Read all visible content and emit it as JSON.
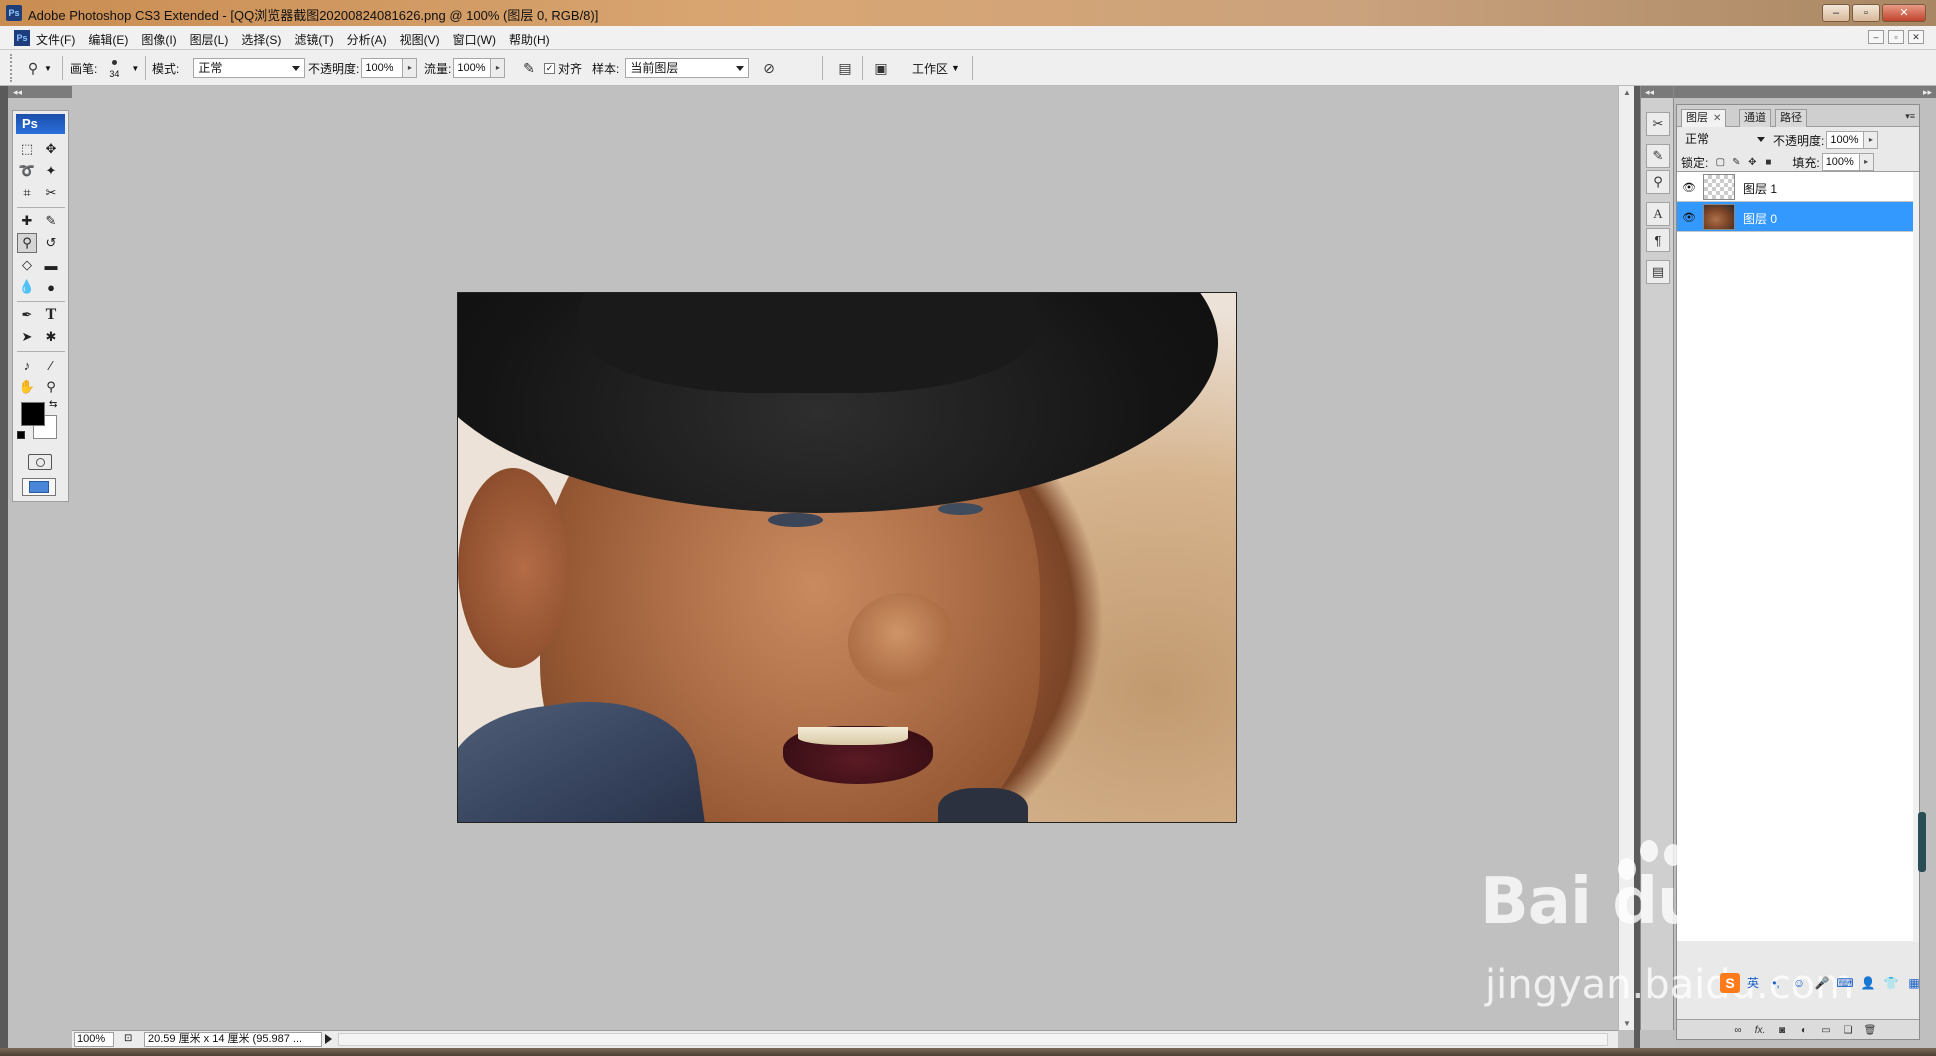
{
  "window": {
    "app_icon": "Ps",
    "title": "Adobe Photoshop CS3 Extended - [QQ浏览器截图20200824081626.png @ 100% (图层 0, RGB/8)]",
    "buttons": {
      "minimize": "–",
      "maximize": "▫",
      "close": "✕"
    }
  },
  "menubar": {
    "icon": "Ps",
    "items": [
      "文件(F)",
      "编辑(E)",
      "图像(I)",
      "图层(L)",
      "选择(S)",
      "滤镜(T)",
      "分析(A)",
      "视图(V)",
      "窗口(W)",
      "帮助(H)"
    ],
    "doc_buttons": [
      "–",
      "▫",
      "✕"
    ]
  },
  "options": {
    "brush_label": "画笔:",
    "brush_size": "34",
    "mode_label": "模式:",
    "mode_value": "正常",
    "opacity_label": "不透明度:",
    "opacity_value": "100%",
    "flow_label": "流量:",
    "flow_value": "100%",
    "aligned_label": "对齐",
    "aligned_checked": "✓",
    "sample_label": "样本:",
    "sample_value": "当前图层",
    "workspace_label": "工作区"
  },
  "toolbox": {
    "logo": "Ps"
  },
  "statusbar": {
    "zoom": "100%",
    "doc_info": "20.59 厘米 x 14 厘米 (95.987 ..."
  },
  "layers_panel": {
    "tabs": [
      {
        "label": "图层",
        "close": "✕"
      },
      {
        "label": "通道"
      },
      {
        "label": "路径"
      }
    ],
    "blend_mode": "正常",
    "opacity_label": "不透明度:",
    "opacity_value": "100%",
    "lock_label": "锁定:",
    "fill_label": "填充:",
    "fill_value": "100%",
    "layers": [
      {
        "name": "图层 1",
        "selected": false
      },
      {
        "name": "图层 0",
        "selected": true
      }
    ],
    "footer_fx": "fx."
  },
  "watermark": {
    "logo": "Bai du 经验",
    "url": "jingyan.baidu.com"
  },
  "ime": {
    "logo": "S",
    "label": "英"
  },
  "colors": {
    "foreground": "#000000",
    "background": "#ffffff",
    "selection": "#3399ff",
    "workspace": "#c0c0c0"
  }
}
